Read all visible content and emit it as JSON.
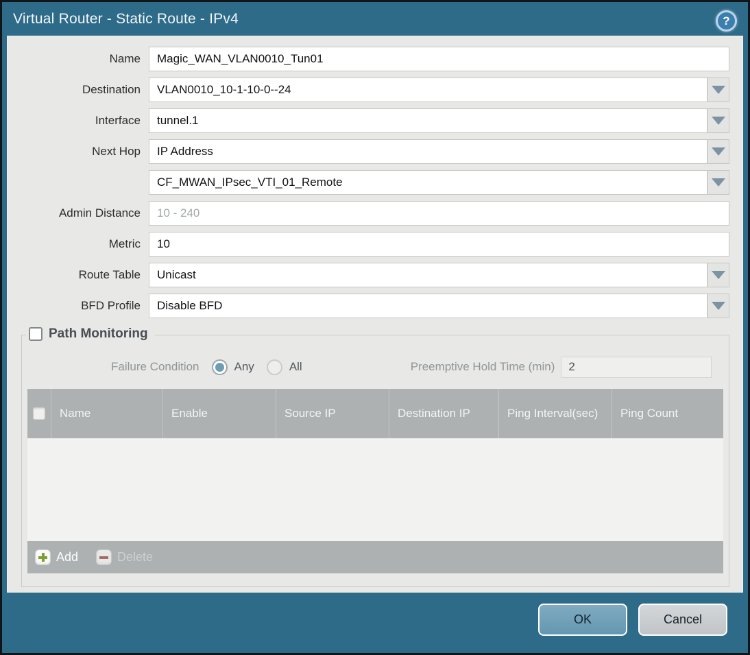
{
  "titlebar": {
    "title": "Virtual Router - Static Route - IPv4",
    "help_icon": "help"
  },
  "form": {
    "fields": [
      {
        "label": "Name",
        "value": "Magic_WAN_VLAN0010_Tun01"
      },
      {
        "label": "Destination",
        "value": "VLAN0010_10-1-10-0--24"
      },
      {
        "label": "Interface",
        "value": "tunnel.1"
      },
      {
        "label": "Next Hop",
        "value": "IP Address"
      },
      {
        "label": "",
        "value": "CF_MWAN_IPsec_VTI_01_Remote"
      },
      {
        "label": "Admin Distance",
        "value": "",
        "placeholder": "10 - 240"
      },
      {
        "label": "Metric",
        "value": "10"
      },
      {
        "label": "Route Table",
        "value": "Unicast"
      },
      {
        "label": "BFD Profile",
        "value": "Disable BFD"
      }
    ]
  },
  "path_monitoring": {
    "title": "Path Monitoring",
    "checkbox_checked": false,
    "failure_condition_label": "Failure Condition",
    "radio_any_label": "Any",
    "radio_all_label": "All",
    "radio_selected": "Any",
    "preemptive_hold_label": "Preemptive Hold Time (min)",
    "preemptive_hold_value": "2",
    "table": {
      "columns": [
        "Name",
        "Enable",
        "Source IP",
        "Destination IP",
        "Ping Interval(sec)",
        "Ping Count"
      ],
      "rows": []
    },
    "add_label": "Add",
    "delete_label": "Delete"
  },
  "footer": {
    "ok_label": "OK",
    "cancel_label": "Cancel"
  },
  "colors": {
    "frame_teal": "#2e6b89",
    "panel_gray": "#e8e8e6",
    "table_header_gray": "#adb1b1",
    "ok_button_blue": "#6f9fb7",
    "dropdown_arrow": "#7e93a2",
    "add_plus_green": "#7aa22e",
    "delete_minus_red": "#a2584e",
    "radio_selected_fill": "#6d9cb4"
  }
}
